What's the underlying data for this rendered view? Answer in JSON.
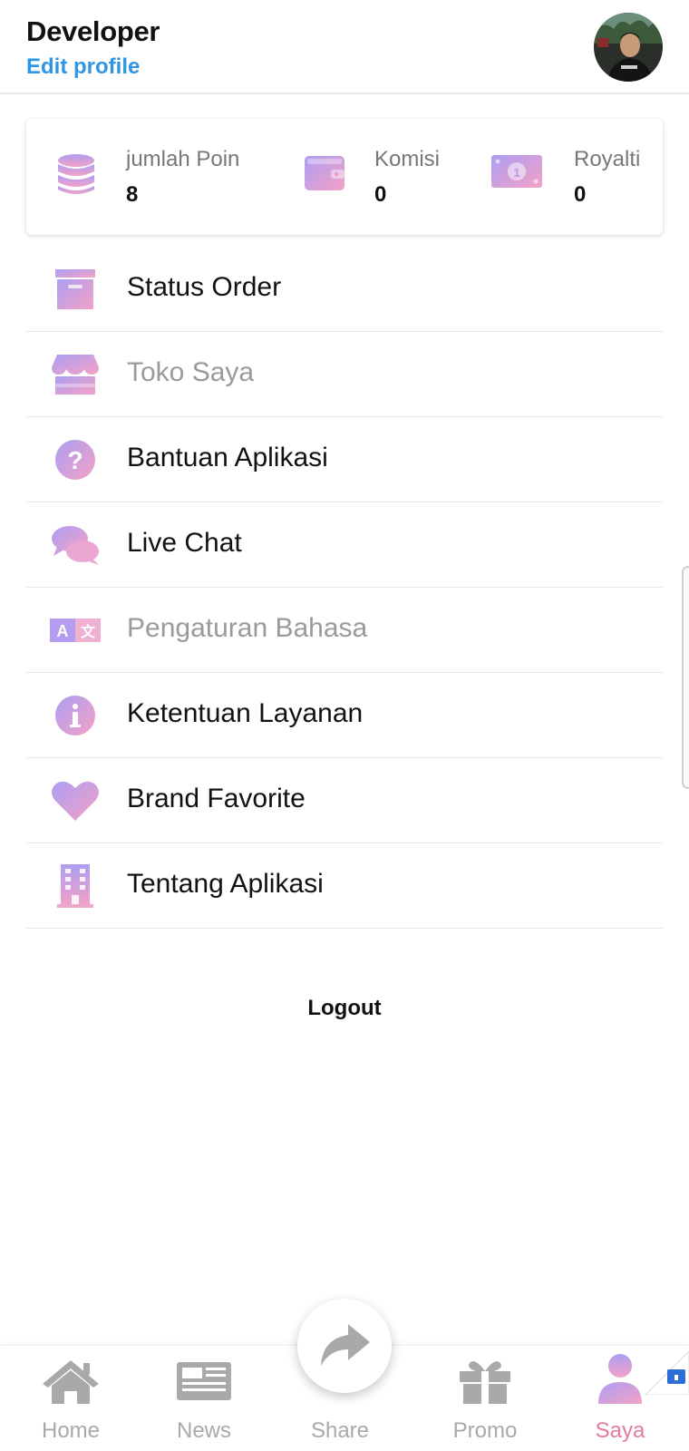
{
  "profile": {
    "name": "Developer",
    "edit_label": "Edit profile"
  },
  "stats": [
    {
      "label": "jumlah Poin",
      "value": "8",
      "icon": "coins-icon"
    },
    {
      "label": "Komisi",
      "value": "0",
      "icon": "wallet-icon"
    },
    {
      "label": "Royalti",
      "value": "0",
      "icon": "money-bill-icon"
    }
  ],
  "menu": [
    {
      "label": "Status Order",
      "icon": "archive-box-icon",
      "enabled": true
    },
    {
      "label": "Toko Saya",
      "icon": "store-icon",
      "enabled": false
    },
    {
      "label": "Bantuan Aplikasi",
      "icon": "question-circle-icon",
      "enabled": true
    },
    {
      "label": "Live Chat",
      "icon": "chat-bubbles-icon",
      "enabled": true
    },
    {
      "label": "Pengaturan Bahasa",
      "icon": "language-icon",
      "enabled": false
    },
    {
      "label": "Ketentuan Layanan",
      "icon": "info-circle-icon",
      "enabled": true
    },
    {
      "label": "Brand Favorite",
      "icon": "heart-icon",
      "enabled": true
    },
    {
      "label": "Tentang Aplikasi",
      "icon": "building-icon",
      "enabled": true
    }
  ],
  "logout_label": "Logout",
  "bottom_nav": [
    {
      "label": "Home",
      "icon": "home-icon",
      "active": false
    },
    {
      "label": "News",
      "icon": "newspaper-icon",
      "active": false
    },
    {
      "label": "Share",
      "icon": "share-icon",
      "active": false
    },
    {
      "label": "Promo",
      "icon": "gift-icon",
      "active": false
    },
    {
      "label": "Saya",
      "icon": "user-icon",
      "active": true
    }
  ],
  "colors": {
    "link": "#2e96e6",
    "gradient_start": "#b09cf0",
    "gradient_end": "#f0a0c8",
    "active_nav": "#e57a9a",
    "inactive_nav": "#a9a9a9"
  }
}
